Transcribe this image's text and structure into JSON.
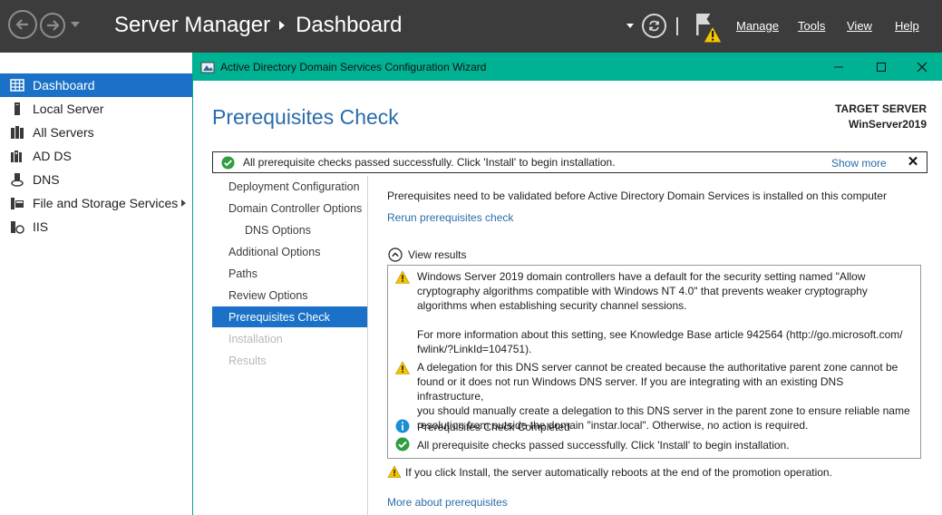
{
  "server_manager": {
    "title": "Server Manager",
    "page": "Dashboard",
    "menu": {
      "manage": "Manage",
      "tools": "Tools",
      "view": "View",
      "help": "Help"
    }
  },
  "sidebar": {
    "items": [
      {
        "label": "Dashboard",
        "icon": "dashboard-icon"
      },
      {
        "label": "Local Server",
        "icon": "local-server-icon"
      },
      {
        "label": "All Servers",
        "icon": "all-servers-icon"
      },
      {
        "label": "AD DS",
        "icon": "ad-ds-icon"
      },
      {
        "label": "DNS",
        "icon": "dns-icon"
      },
      {
        "label": "File and Storage Services",
        "icon": "file-storage-icon"
      },
      {
        "label": "IIS",
        "icon": "iis-icon"
      }
    ]
  },
  "wizard": {
    "window_title": "Active Directory Domain Services Configuration Wizard",
    "page_title": "Prerequisites Check",
    "target_label": "TARGET SERVER",
    "target_value": "WinServer2019",
    "banner": {
      "text": "All prerequisite checks passed successfully.  Click 'Install' to begin installation.",
      "show_more": "Show more"
    },
    "steps": [
      {
        "label": "Deployment Configuration",
        "state": "normal"
      },
      {
        "label": "Domain Controller Options",
        "state": "normal"
      },
      {
        "label": "DNS Options",
        "state": "sub"
      },
      {
        "label": "Additional Options",
        "state": "normal"
      },
      {
        "label": "Paths",
        "state": "normal"
      },
      {
        "label": "Review Options",
        "state": "normal"
      },
      {
        "label": "Prerequisites Check",
        "state": "active"
      },
      {
        "label": "Installation",
        "state": "disabled"
      },
      {
        "label": "Results",
        "state": "disabled"
      }
    ],
    "intro": "Prerequisites need to be validated before Active Directory Domain Services is installed on this computer",
    "rerun_link": "Rerun prerequisites check",
    "view_results": "View results",
    "results": [
      {
        "type": "warning",
        "icon": "warning-icon",
        "lines": [
          "Windows Server 2019 domain controllers have a default for the security setting named \"Allow",
          "cryptography algorithms compatible with Windows NT 4.0\" that prevents weaker cryptography",
          "algorithms when establishing security channel sessions."
        ],
        "extra_lines": [
          "For more information about this setting, see Knowledge Base article 942564 (http://go.microsoft.com/",
          "fwlink/?LinkId=104751)."
        ]
      },
      {
        "type": "warning",
        "icon": "warning-icon",
        "lines": [
          "A delegation for this DNS server cannot be created because the authoritative parent zone cannot be",
          "found or it does not run Windows DNS server. If you are integrating with an existing DNS infrastructure,",
          "you should manually create a delegation to this DNS server in the parent zone to ensure reliable name",
          "resolution from outside the domain \"instar.local\". Otherwise, no action is required."
        ]
      },
      {
        "type": "info",
        "icon": "info-icon",
        "lines": [
          "Prerequisites Check Completed"
        ]
      },
      {
        "type": "success",
        "icon": "check-icon",
        "lines": [
          "All prerequisite checks passed successfully.  Click 'Install' to begin installation."
        ]
      }
    ],
    "reboot_note": "If you click Install, the server automatically reboots at the end of the promotion operation.",
    "more_link": "More about prerequisites"
  },
  "colors": {
    "header_bg": "#3c3c3c",
    "wizard_title_bg": "#00b294",
    "selection_blue": "#1a71c7",
    "link_blue": "#2a6ca8",
    "warning_yellow": "#f5c400",
    "success_green": "#2e9e3e",
    "info_blue": "#1b8fd6"
  }
}
